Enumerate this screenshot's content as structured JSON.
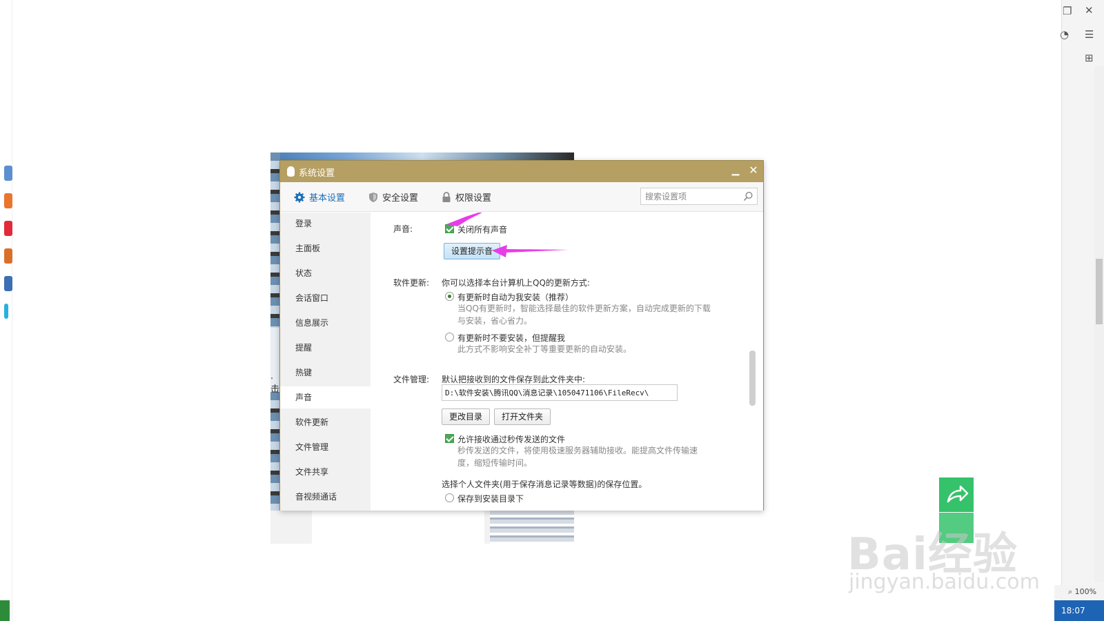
{
  "window": {
    "title": "系统设置"
  },
  "tabs": [
    {
      "label": "基本设置"
    },
    {
      "label": "安全设置"
    },
    {
      "label": "权限设置"
    }
  ],
  "search": {
    "placeholder": "搜索设置项"
  },
  "sidebar": {
    "items": [
      {
        "label": "登录"
      },
      {
        "label": "主面板"
      },
      {
        "label": "状态"
      },
      {
        "label": "会话窗口"
      },
      {
        "label": "信息展示"
      },
      {
        "label": "提醒"
      },
      {
        "label": "热键"
      },
      {
        "label": "声音"
      },
      {
        "label": "软件更新"
      },
      {
        "label": "文件管理"
      },
      {
        "label": "文件共享"
      },
      {
        "label": "音视频通话"
      }
    ]
  },
  "sound": {
    "label": "声音:",
    "mute_all_label": "关闭所有声音",
    "mute_all_checked": true,
    "set_tone_button": "设置提示音"
  },
  "update": {
    "label": "软件更新:",
    "intro": "你可以选择本台计算机上QQ的更新方式:",
    "option_auto": "有更新时自动为我安装（推荐）",
    "option_auto_desc_1": "当QQ有更新时，智能选择最佳的软件更新方案，自动完成更新的下载",
    "option_auto_desc_2": "与安装，省心省力。",
    "option_remind": "有更新时不要安装，但提醒我",
    "option_remind_desc": "此方式不影响安全补丁等重要更新的自动安装。",
    "selected": "auto"
  },
  "files": {
    "label": "文件管理:",
    "intro": "默认把接收到的文件保存到此文件夹中:",
    "path": "D:\\软件安装\\腾讯QQ\\消息记录\\1050471106\\FileRecv\\",
    "change_dir_button": "更改目录",
    "open_folder_button": "打开文件夹",
    "allow_instant_label": "允许接收通过秒传发送的文件",
    "allow_instant_checked": true,
    "allow_instant_desc_1": "秒传发送的文件，将使用极速服务器辅助接收。能提高文件传输速",
    "allow_instant_desc_2": "度，缩短传输时间。",
    "personal_folder_intro": "选择个人文件夹(用于保存消息记录等数据)的保存位置。",
    "save_to_install_dir": "保存到安装目录下"
  },
  "status": {
    "zoom": "100%",
    "clock": "18:07"
  },
  "watermark": {
    "logo": "Bai经验",
    "url": "jingyan.baidu.com"
  },
  "colors": {
    "titlebar": "#b69f62",
    "accent": "#1d6fb8",
    "check_green": "#4aa957",
    "annotation_arrow": "#e93be9",
    "share_green": "#35c26b"
  }
}
